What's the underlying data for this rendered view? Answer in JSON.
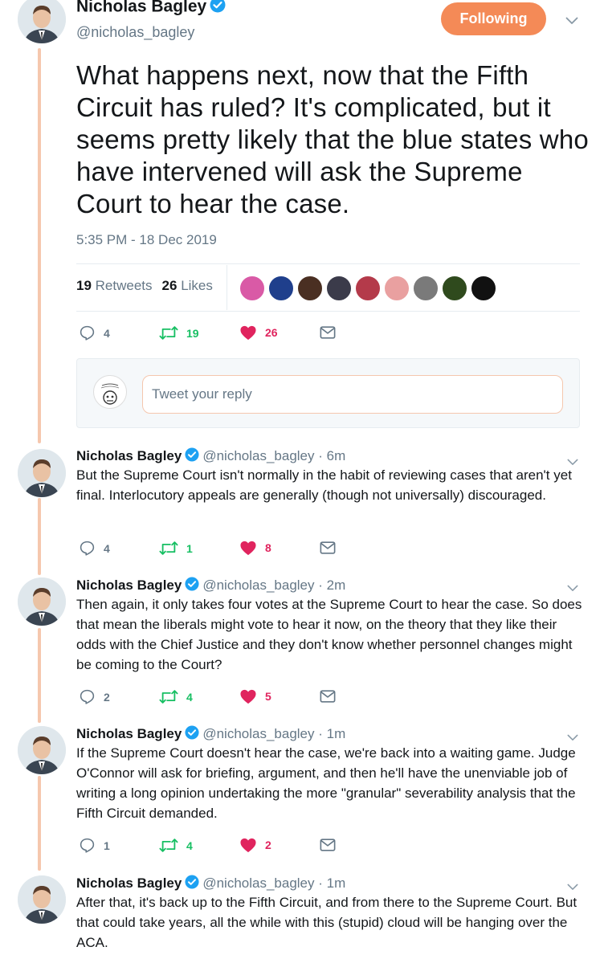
{
  "main_tweet": {
    "name": "Nicholas Bagley",
    "handle": "@nicholas_bagley",
    "follow_label": "Following",
    "text": "What happens next, now that the Fifth Circuit has ruled? It's complicated, but it seems pretty likely that the blue states who have intervened will ask the Supreme Court to hear the case.",
    "timestamp": "5:35 PM - 18 Dec 2019",
    "retweets_count": "19",
    "retweets_label": "Retweets",
    "likes_count": "26",
    "likes_label": "Likes",
    "likers": [
      {
        "icon": "liker-avatar",
        "color": "#d95aa6"
      },
      {
        "icon": "liker-avatar",
        "color": "#1f3f8c"
      },
      {
        "icon": "liker-avatar",
        "color": "#4a2f22"
      },
      {
        "icon": "liker-avatar",
        "color": "#3b3b4a"
      },
      {
        "icon": "liker-avatar",
        "color": "#b43a4a"
      },
      {
        "icon": "liker-avatar",
        "color": "#e9a0a0"
      },
      {
        "icon": "liker-avatar",
        "color": "#7a7a7a"
      },
      {
        "icon": "liker-avatar",
        "color": "#2f4a1d"
      },
      {
        "icon": "liker-avatar",
        "color": "#111111"
      }
    ],
    "actions": {
      "replies": "4",
      "retweets": "19",
      "likes": "26"
    }
  },
  "reply_box": {
    "placeholder": "Tweet your reply"
  },
  "replies": [
    {
      "name": "Nicholas Bagley",
      "handle": "@nicholas_bagley · 6m",
      "text": "But the Supreme Court isn't normally in the habit of reviewing cases that aren't yet final. Interlocutory appeals are generally (though not universally) discouraged.",
      "replies": "4",
      "retweets": "1",
      "likes": "8"
    },
    {
      "name": "Nicholas Bagley",
      "handle": "@nicholas_bagley · 2m",
      "text": "Then again, it only takes four votes at the Supreme Court to hear the case. So does that mean the liberals might vote to hear it now, on the theory that they like their odds with the Chief Justice and they don't know whether personnel changes might be coming to the Court?",
      "replies": "2",
      "retweets": "4",
      "likes": "5"
    },
    {
      "name": "Nicholas Bagley",
      "handle": "@nicholas_bagley · 1m",
      "text": "If the Supreme Court doesn't hear the case, we're back into a waiting game. Judge O'Connor will ask for briefing, argument, and then he'll have the unenviable job of writing a long opinion undertaking the more \"granular\" severability analysis that the Fifth Circuit demanded.",
      "replies": "1",
      "retweets": "4",
      "likes": "2"
    },
    {
      "name": "Nicholas Bagley",
      "handle": "@nicholas_bagley · 1m",
      "text": "After that, it's back up to the Fifth Circuit, and from there to the Supreme Court. But that could take years, all the while with this (stupid) cloud will be hanging over the ACA."
    }
  ],
  "colors": {
    "accent": "#f48a57",
    "thread_line": "#f5c7ae",
    "retweet_green": "#17bf63",
    "like_red": "#e0245e",
    "verified_blue": "#1da1f2"
  }
}
